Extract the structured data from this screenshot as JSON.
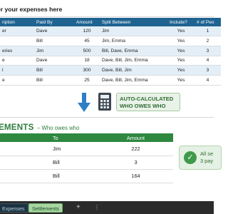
{
  "instruction": "er your expenses here",
  "expenses": {
    "headers": [
      "ription",
      "Paid By",
      "Amount",
      "Split Between",
      "Include?",
      "# of Peo"
    ],
    "rows": [
      [
        "er",
        "Dave",
        "120",
        "Jim",
        "Yes",
        "1"
      ],
      [
        "",
        "Bill",
        "45",
        "Jim, Emma",
        "Yes",
        "2"
      ],
      [
        "eries",
        "Jim",
        "500",
        "Bill, Dave, Emma",
        "Yes",
        "3"
      ],
      [
        "e",
        "Dave",
        "18",
        "Dave, Bill, Jim, Emma",
        "Yes",
        "4"
      ],
      [
        "l",
        "Bill",
        "300",
        "Dave, Bill, Jim",
        "Yes",
        "3"
      ],
      [
        "e",
        "Bill",
        "25",
        "Dave, Bill, Jim, Emma",
        "Yes",
        "4"
      ]
    ]
  },
  "auto_calc": {
    "line1": "AUTO-CALCULATED",
    "line2": "WHO OWES WHO",
    "arrow_icon": "down-arrow-icon",
    "calc_icon": "calculator-icon",
    "arrow_color": "#2f7fc4"
  },
  "settlements": {
    "title": "EMENTS",
    "subtitle": "– Who owes who",
    "headers": [
      "",
      "To",
      "Amount"
    ],
    "rows": [
      [
        "",
        "Jim",
        "222"
      ],
      [
        "",
        "Bill",
        "3"
      ],
      [
        "",
        "Bill",
        "164"
      ]
    ]
  },
  "done": {
    "icon": "check-icon",
    "line1": "All se",
    "line2": "3 pay"
  },
  "sheet_tabs": {
    "expenses": "Expenses",
    "settlements": "Settlements",
    "add": "+",
    "more": "⋮"
  },
  "colors": {
    "table_header_blue": "#1f6391",
    "row_alt_blue": "#e4eef7",
    "settle_green": "#2e8840",
    "accent_green": "#2d7d3c"
  }
}
